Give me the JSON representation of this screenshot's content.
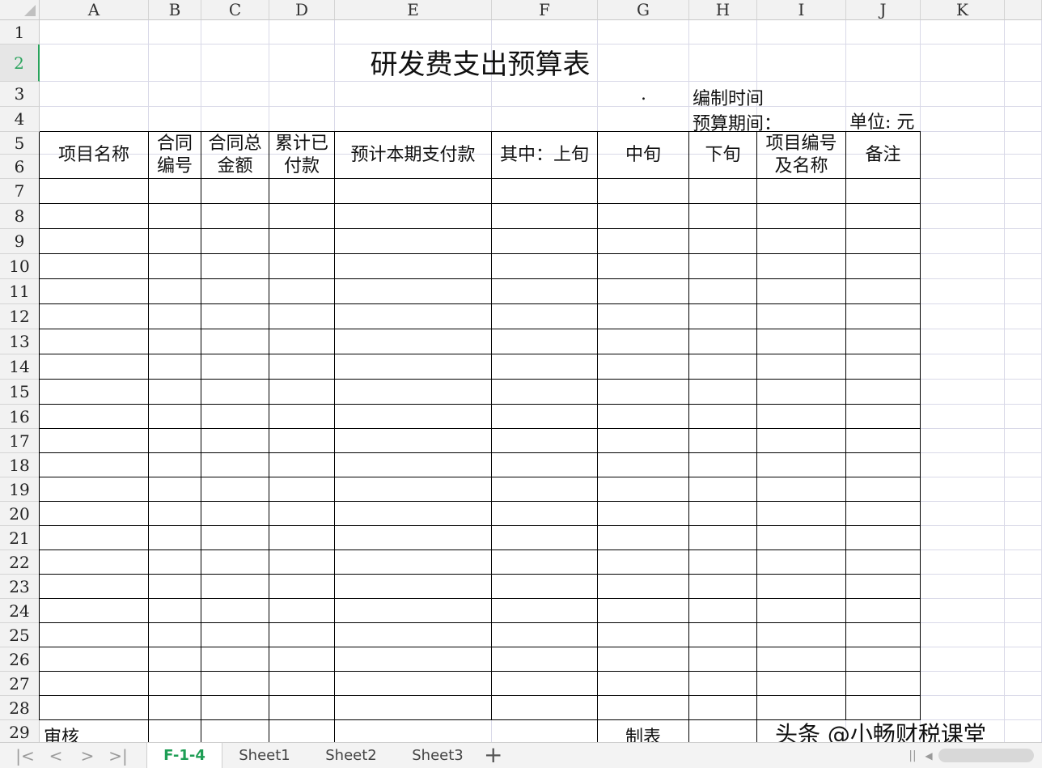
{
  "columns": [
    "A",
    "B",
    "C",
    "D",
    "E",
    "F",
    "G",
    "H",
    "I",
    "J",
    "K"
  ],
  "rows": [
    "1",
    "2",
    "3",
    "4",
    "5",
    "6",
    "7",
    "8",
    "9",
    "10",
    "11",
    "12",
    "13",
    "14",
    "15",
    "16",
    "17",
    "18",
    "19",
    "20",
    "21",
    "22",
    "23",
    "24",
    "25",
    "26",
    "27",
    "28",
    "29"
  ],
  "active_row": "2",
  "sheet": {
    "title": "研发费支出预算表",
    "dot": ".",
    "compile_time_label": "编制时间",
    "budget_period_label": "预算期间：",
    "unit_label": "单位: 元",
    "headers": {
      "project_name": "项目名称",
      "contract_no": "合同\n编号",
      "contract_total": "合同总\n金额",
      "cumulative_paid": "累计已\n付款",
      "expected_payment": "预计本期支付款",
      "first_ten_days": "其中：上旬",
      "mid_ten_days": "中旬",
      "last_ten_days": "下旬",
      "project_no_name": "项目编号\n及名称",
      "remarks": "备注"
    },
    "review_label": "审核",
    "prepared_by_label": "制表"
  },
  "tabs": [
    "F-1-4",
    "Sheet1",
    "Sheet2",
    "Sheet3"
  ],
  "active_tab": "F-1-4",
  "watermark": "头条 @小畅财税课堂"
}
